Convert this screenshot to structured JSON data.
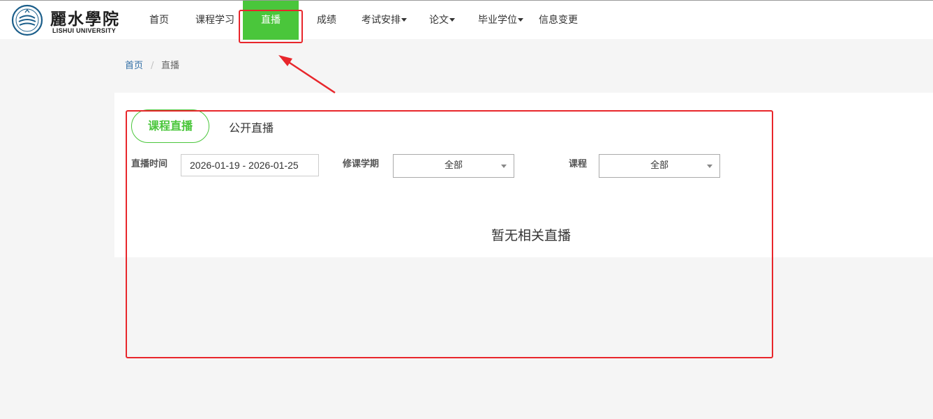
{
  "logo": {
    "name_cn": "麗水學院",
    "name_en": "LISHUI UNIVERSITY"
  },
  "nav": {
    "items": [
      {
        "label": "首页"
      },
      {
        "label": "课程学习"
      },
      {
        "label": "直播"
      },
      {
        "label": "成绩"
      },
      {
        "label": "考试安排"
      },
      {
        "label": "论文"
      },
      {
        "label": "毕业学位"
      },
      {
        "label": "信息变更"
      }
    ],
    "active": "直播"
  },
  "breadcrumb": {
    "home": "首页",
    "separator": "/",
    "current": "直播"
  },
  "tabs": {
    "course_live": "课程直播",
    "public_live": "公开直播"
  },
  "filters": {
    "live_time_label": "直播时间",
    "live_time_value": "2026-01-19 - 2026-01-25",
    "semester_label": "修课学期",
    "semester_value": "全部",
    "course_label": "课程",
    "course_value": "全部"
  },
  "empty_message": "暂无相关直播",
  "colors": {
    "accent_green": "#4ac63b",
    "annotation_red": "#e8262b",
    "link_blue": "#2f6da5"
  }
}
